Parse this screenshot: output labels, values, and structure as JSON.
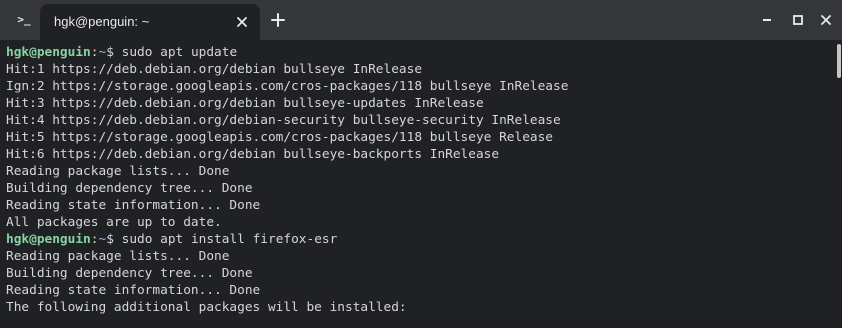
{
  "tab": {
    "title": "hgk@penguin: ~",
    "app_icon": ">_"
  },
  "icons": {
    "app": "terminal-icon",
    "tab_close": "close-icon",
    "new_tab": "plus-icon",
    "minimize": "minimize-icon",
    "maximize": "maximize-icon",
    "close": "close-icon"
  },
  "colors": {
    "background": "#202124",
    "tabbar": "#35363a",
    "text": "#d5d6d7",
    "prompt_user": "#8ad2a3",
    "prompt_path": "#8ab4f8"
  },
  "terminal": {
    "prompt": {
      "user": "hgk@penguin",
      "sep": ":",
      "path": "~",
      "symbol": "$ "
    },
    "commands": [
      "sudo apt update",
      "sudo apt install firefox-esr"
    ],
    "output1": [
      "Hit:1 https://deb.debian.org/debian bullseye InRelease",
      "Ign:2 https://storage.googleapis.com/cros-packages/118 bullseye InRelease",
      "Hit:3 https://deb.debian.org/debian bullseye-updates InRelease",
      "Hit:4 https://deb.debian.org/debian-security bullseye-security InRelease",
      "Hit:5 https://storage.googleapis.com/cros-packages/118 bullseye Release",
      "Hit:6 https://deb.debian.org/debian bullseye-backports InRelease",
      "Reading package lists... Done",
      "Building dependency tree... Done",
      "Reading state information... Done",
      "All packages are up to date."
    ],
    "output2": [
      "Reading package lists... Done",
      "Building dependency tree... Done",
      "Reading state information... Done",
      "The following additional packages will be installed:"
    ]
  }
}
